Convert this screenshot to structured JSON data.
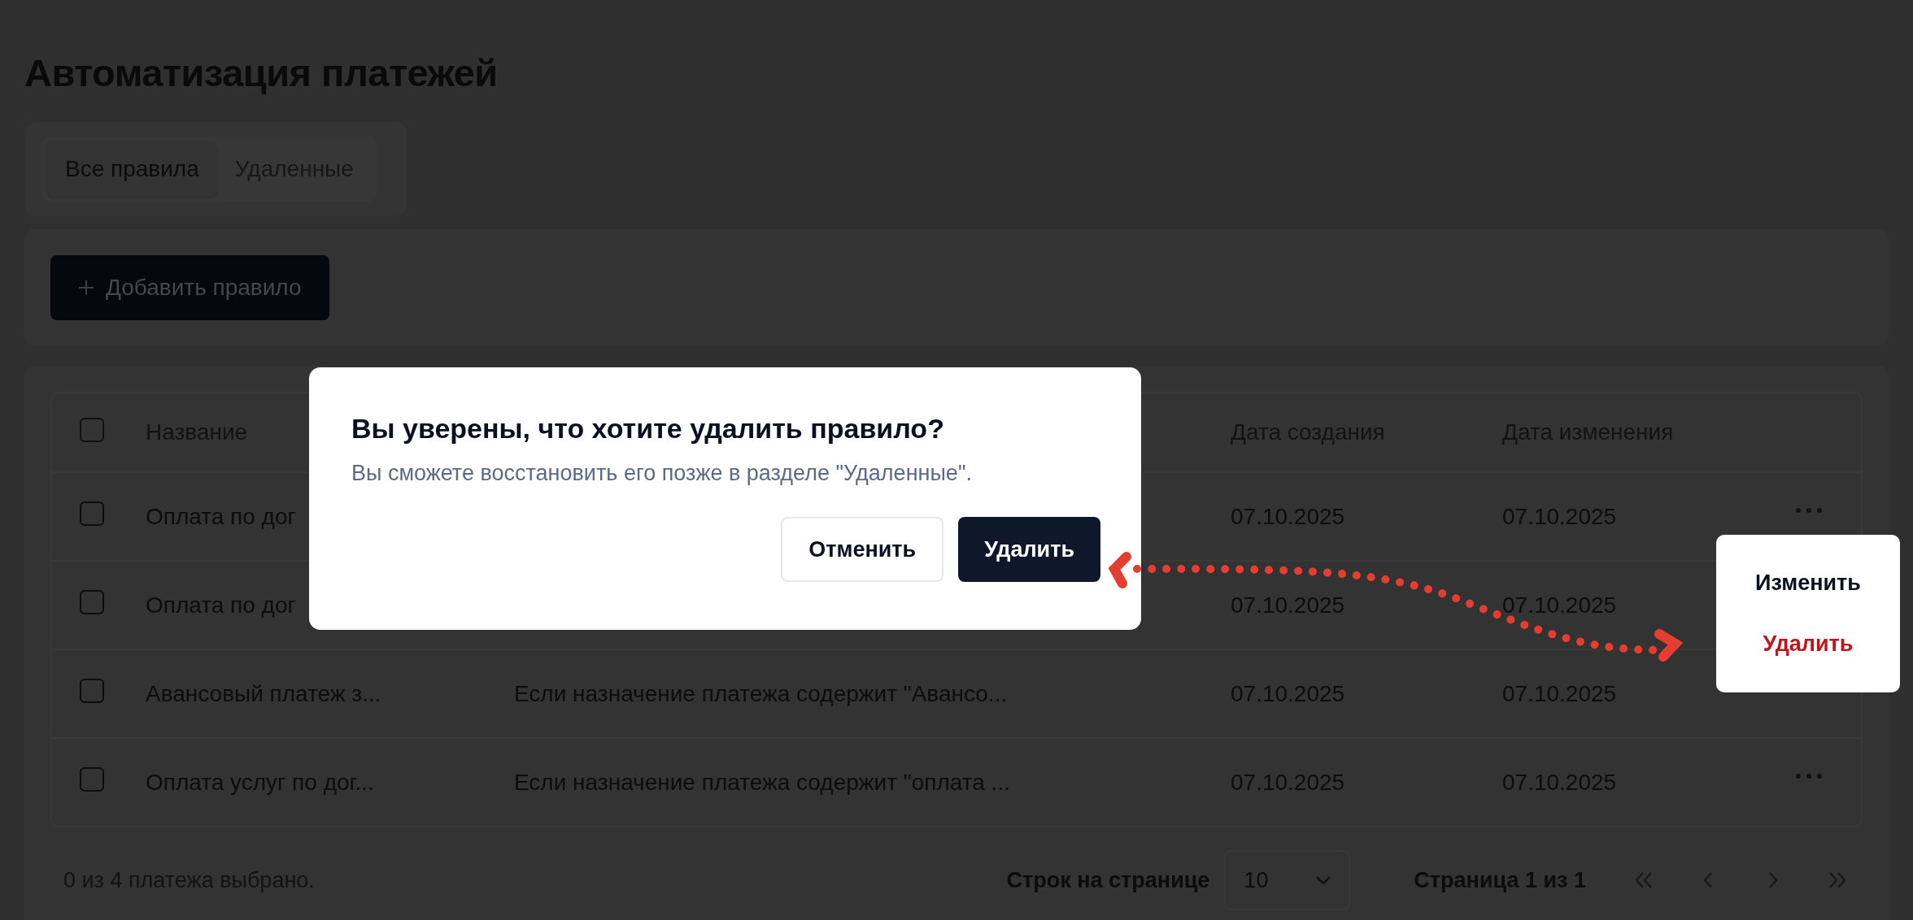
{
  "page": {
    "title": "Автоматизация платежей"
  },
  "tabs": [
    {
      "label": "Все правила",
      "selected": true
    },
    {
      "label": "Удаленные",
      "selected": false
    }
  ],
  "toolbar": {
    "add_button": {
      "label": "Добавить правило"
    }
  },
  "table": {
    "header_checked": false,
    "columns": [
      {
        "kind": "name",
        "label": "Название"
      },
      {
        "kind": "created",
        "label": "Дата создания"
      },
      {
        "kind": "modified",
        "label": "Дата изменения"
      }
    ],
    "rows": [
      {
        "checked": false,
        "name": "Оплата по дог",
        "created": "07.10.2025",
        "modified": "07.10.2025",
        "menu_button": true
      },
      {
        "checked": false,
        "name": "Оплата по дог",
        "created": "07.10.2025",
        "modified": "07.10.2025",
        "menu_button": false
      },
      {
        "checked": false,
        "name": "Авансовый платеж з...",
        "condition": "Если назначение платежа содержит \"Авансо...",
        "created": "07.10.2025",
        "modified": "07.10.2025",
        "menu_button": false
      },
      {
        "checked": false,
        "name": "Оплата услуг по дог...",
        "condition": "Если назначение платежа содержит \"оплата ...",
        "created": "07.10.2025",
        "modified": "07.10.2025",
        "menu_button": true
      }
    ]
  },
  "footer": {
    "selection": "0 из 4 платежа выбрано.",
    "rows_per_page_label": "Строк на странице",
    "rows_per_page": "10",
    "page_label": "Страница 1 из 1"
  },
  "dialog": {
    "title": "Вы уверены, что хотите удалить правило?",
    "description": "Вы сможете восстановить его позже в разделе \"Удаленные\".",
    "buttons": [
      {
        "label": "Отменить",
        "kind": "secondary"
      },
      {
        "label": "Удалить",
        "kind": "primary"
      }
    ]
  },
  "context_menu": {
    "items": [
      {
        "label": "Изменить",
        "kind": "default"
      },
      {
        "label": "Удалить",
        "kind": "danger"
      }
    ]
  }
}
